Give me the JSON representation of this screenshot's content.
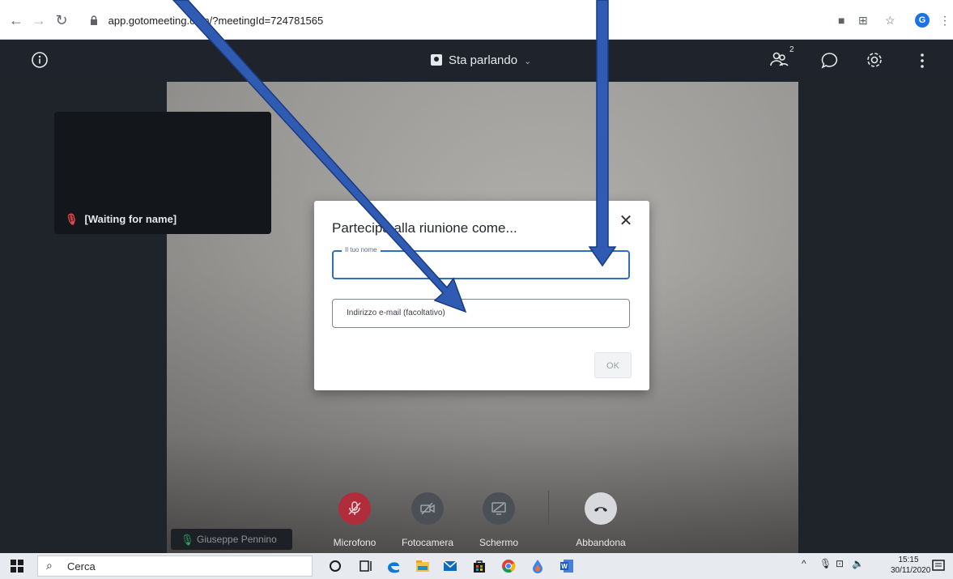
{
  "browser": {
    "url": "app.gotomeeting.com/?meetingId=724781565",
    "profile_initial": "G"
  },
  "header": {
    "view_label": "Sta parlando",
    "participant_count": "2"
  },
  "thumbnail": {
    "label": "[Waiting for name]"
  },
  "dialog": {
    "title": "Partecipa alla riunione come...",
    "name_label": "Il tuo nome",
    "email_placeholder": "Indirizzo e-mail (facoltativo)",
    "ok_label": "OK"
  },
  "controls": {
    "mic_label": "Microfono",
    "camera_label": "Fotocamera",
    "screen_label": "Schermo",
    "leave_label": "Abbandona",
    "self_name": "Giuseppe Pennino"
  },
  "taskbar": {
    "search_label": "Cerca",
    "time": "15:15",
    "date": "30/11/2020"
  },
  "colors": {
    "accent": "#306fb5",
    "mic_muted": "#b22d3b",
    "arrow": "#2f5bb3"
  }
}
